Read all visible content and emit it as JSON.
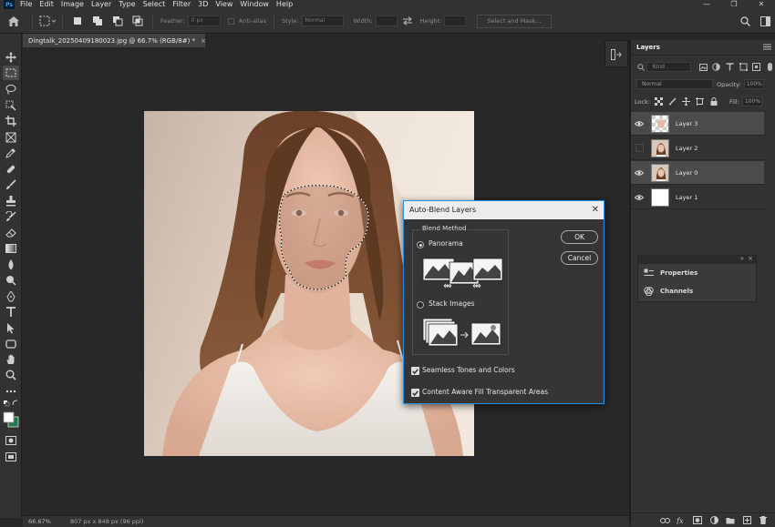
{
  "app": {
    "logo": "Ps"
  },
  "menubar": {
    "items": [
      "File",
      "Edit",
      "Image",
      "Layer",
      "Type",
      "Select",
      "Filter",
      "3D",
      "View",
      "Window",
      "Help"
    ],
    "minimize": "—",
    "restore": "❐",
    "close": "✕"
  },
  "options": {
    "feather_label": "Feather:",
    "feather_value": "0 px",
    "antialias_label": "Anti-alias",
    "style_label": "Style:",
    "style_value": "Normal",
    "width_label": "Width:",
    "height_label": "Height:",
    "select_mask_label": "Select and Mask..."
  },
  "document": {
    "tab_title": "Dingtalk_20250409180023.jpg @ 66.7% (RGB/8#) *",
    "tab_close": "×"
  },
  "status": {
    "zoom": "66.67%",
    "doc_info": "807 px x 848 px (96 ppi)"
  },
  "layers_panel": {
    "title": "Layers",
    "kind_placeholder": "Kind",
    "blend_mode": "Normal",
    "opacity_label": "Opacity:",
    "opacity_value": "100%",
    "lock_label": "Lock:",
    "fill_label": "Fill:",
    "fill_value": "100%",
    "layers": [
      {
        "name": "Layer 3",
        "visible": true,
        "selected": true
      },
      {
        "name": "Layer 2",
        "visible": false,
        "selected": false
      },
      {
        "name": "Layer 0",
        "visible": true,
        "selected": true
      },
      {
        "name": "Layer 1",
        "visible": true,
        "selected": false
      }
    ]
  },
  "sub_panel": {
    "collapse": "»",
    "close": "×",
    "properties": "Properties",
    "channels": "Channels"
  },
  "dialog": {
    "title": "Auto-Blend Layers",
    "close": "✕",
    "group_label": "Blend Method",
    "panorama_label": "Panorama",
    "stack_label": "Stack Images",
    "ok_label": "OK",
    "cancel_label": "Cancel",
    "seamless_label": "Seamless Tones and Colors",
    "content_aware_label": "Content Aware Fill Transparent Areas",
    "panorama_selected": true,
    "seamless_checked": true,
    "content_aware_checked": true
  },
  "colors": {
    "accent": "#2f8fe0",
    "background_swatch": "#1f7a4d",
    "foreground_swatch": "#ffffff"
  }
}
